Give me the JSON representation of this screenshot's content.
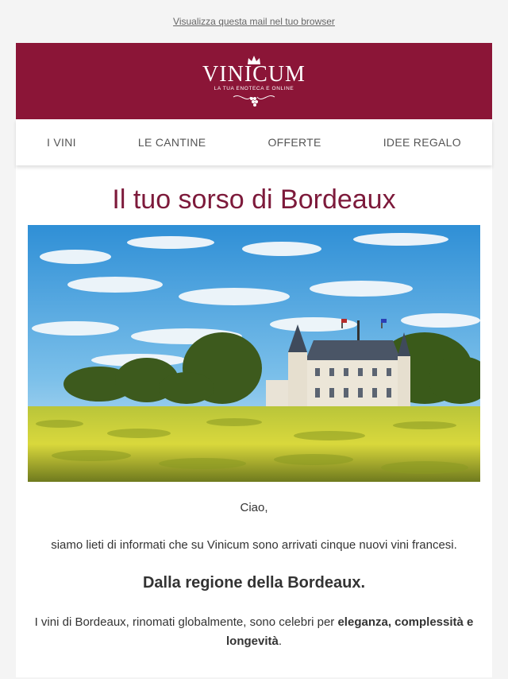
{
  "topbar": {
    "view_in_browser": "Visualizza questa mail nel tuo browser"
  },
  "header": {
    "brand": "VINICUM",
    "tagline": "LA TUA ENOTECA E ONLINE",
    "background": "#8b1537"
  },
  "nav": {
    "items": [
      {
        "label": "I VINI"
      },
      {
        "label": "LE CANTINE"
      },
      {
        "label": "OFFERTE"
      },
      {
        "label": "IDEE REGALO"
      }
    ]
  },
  "content": {
    "title": "Il tuo sorso di Bordeaux",
    "title_color": "#7d1a3b",
    "greeting": "Ciao,",
    "intro": "siamo lieti di informati che su Vinicum sono arrivati cinque nuovi vini francesi.",
    "subhead": "Dalla regione della Bordeaux.",
    "para_start": "I vini di Bordeaux, rinomati globalmente, sono celebri per ",
    "para_bold": "eleganza, complessità e longevità",
    "para_end": "."
  }
}
